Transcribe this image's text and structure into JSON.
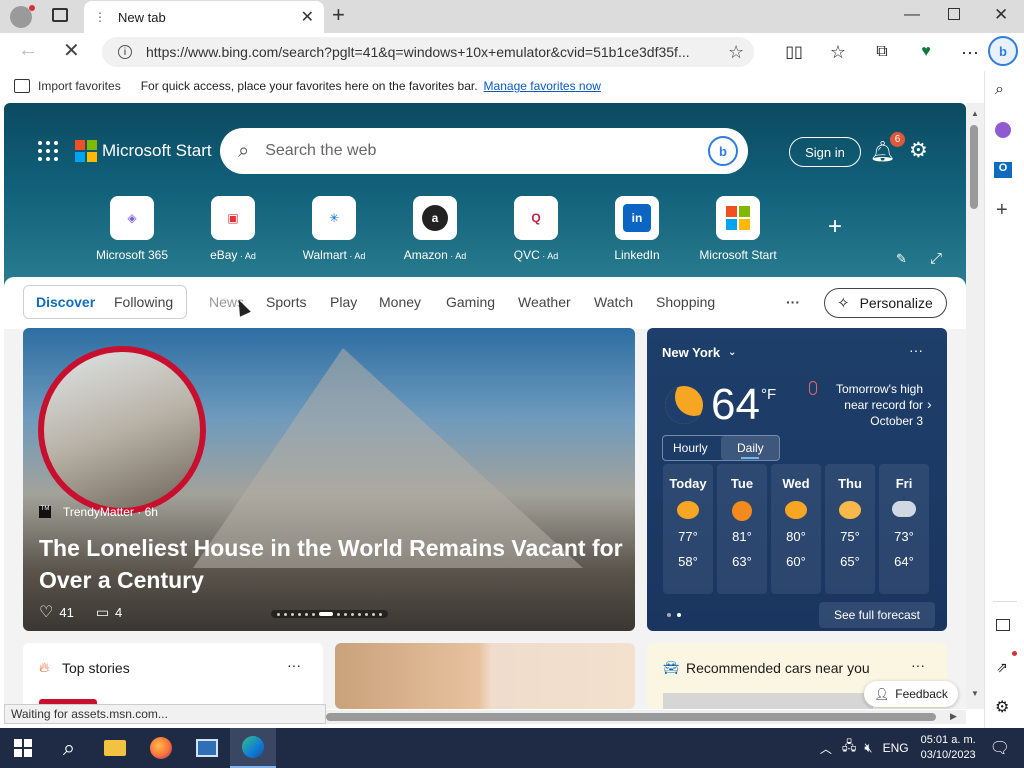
{
  "browser": {
    "tab_title": "New tab",
    "url": "https://www.bing.com/search?pglt=41&q=windows+10x+emulator&cvid=51b1ce3df35f...",
    "fav_import": "Import favorites",
    "fav_hint": "For quick access, place your favorites here on the favorites bar.",
    "fav_manage": "Manage favorites now",
    "status_text": "Waiting for assets.msn.com...",
    "feedback": "Feedback"
  },
  "start": {
    "brand": "Microsoft Start",
    "search_placeholder": "Search the web",
    "signin": "Sign in",
    "notif_count": "6",
    "quicklinks": [
      {
        "label": "Microsoft 365",
        "ad": ""
      },
      {
        "label": "eBay",
        "ad": " · Ad"
      },
      {
        "label": "Walmart",
        "ad": " · Ad"
      },
      {
        "label": "Amazon",
        "ad": " · Ad"
      },
      {
        "label": "QVC",
        "ad": " · Ad"
      },
      {
        "label": "LinkedIn",
        "ad": ""
      },
      {
        "label": "Microsoft Start",
        "ad": ""
      }
    ],
    "nav": {
      "discover": "Discover",
      "following": "Following",
      "news": "News",
      "sports": "Sports",
      "play": "Play",
      "money": "Money",
      "gaming": "Gaming",
      "weather": "Weather",
      "watch": "Watch",
      "shopping": "Shopping",
      "more": "···",
      "personalize": "Personalize"
    },
    "hero_card": {
      "source": "TrendyMatter · 6h",
      "headline": "The Loneliest House in the World Remains Vacant for Over a Century",
      "likes": "41",
      "comments": "4"
    },
    "weather": {
      "city": "New York",
      "temp": "64",
      "unit": "°F",
      "alert": "Tomorrow's high near record for October 3",
      "tab_hourly": "Hourly",
      "tab_daily": "Daily",
      "days": [
        {
          "day": "Today",
          "hi": "77°",
          "lo": "58°"
        },
        {
          "day": "Tue",
          "hi": "81°",
          "lo": "63°"
        },
        {
          "day": "Wed",
          "hi": "80°",
          "lo": "60°"
        },
        {
          "day": "Thu",
          "hi": "75°",
          "lo": "65°"
        },
        {
          "day": "Fri",
          "hi": "73°",
          "lo": "64°"
        }
      ],
      "full_forecast": "See full forecast"
    },
    "top_stories": "Top stories",
    "recommended_cars": "Recommended cars near you"
  },
  "taskbar": {
    "lang": "ENG",
    "time": "05:01 a. m.",
    "date": "03/10/2023"
  }
}
